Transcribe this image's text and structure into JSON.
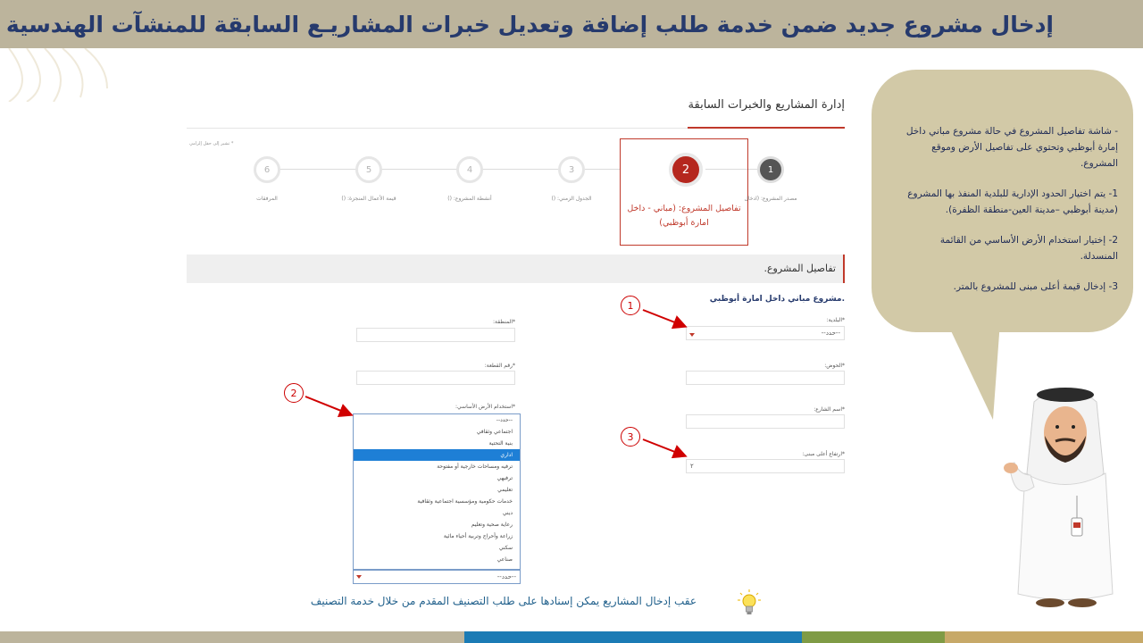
{
  "header": {
    "title": "إدخال مشروع جديد ضمن خدمة طلب إضافة وتعديل خبرات المشاريـع السابقة للمنشآت الهندسية"
  },
  "colors": {
    "header_bg": "#bcb49c",
    "title_color": "#263a6d",
    "accent_red": "#c0392b",
    "bubble_bg": "#d2c9a7",
    "bar_1": "#bcb49c",
    "bar_2": "#1b7bb5",
    "bar_3": "#7f9b45",
    "bar_4": "#c7a968"
  },
  "bubble": {
    "intro": "-    شاشة تفاصيل المشروع في حالة مشروع مباني داخل إمارة أبوظبي وتحتوي على تفاصيل الأرض وموقع المشروع.",
    "point_1": "1- يتم اختيار الحدود الإدارية للبلدية المنفذ بها المشروع (مدينة أبوظبي –مدينة العين-منطقة الظفرة).",
    "point_2": "2- إختيار استخدام الأرض الأساسي من القائمة المنسدلة.",
    "point_3": "3- إدخال قيمة أعلى مبنى للمشروع بالمتر."
  },
  "app": {
    "management_title": "إدارة المشاريع والخبرات السابقة",
    "required_note": "* تشير إلى حقل إلزامي"
  },
  "stepper": {
    "steps": [
      {
        "number": "1",
        "label": "مصدر المشروع: (ادخال"
      },
      {
        "number": "2",
        "label": "تفاصيل المشروع: (مباني - داخل امارة أبوظبي)"
      },
      {
        "number": "3",
        "label": "الجدول الزمني: ()"
      },
      {
        "number": "4",
        "label": "أنشطة المشروع: ()"
      },
      {
        "number": "5",
        "label": "قيمة الأعمال المنجزة: ()"
      },
      {
        "number": "6",
        "label": "المرفقات"
      }
    ]
  },
  "section": {
    "title": "تفاصيل المشروع.",
    "subtitle": ".مشروع مباني داخل امارة أبوظبي"
  },
  "form": {
    "municipality_label": "*البلدية:",
    "municipality_value": "--حدد--",
    "region_label": "*المنطقة:",
    "basin_label": "*الحوض:",
    "plot_label": "*رقم القطعة:",
    "land_use_label": "*استخدام الأرض الأساسي:",
    "street_label": "*اسم الشارع:",
    "height_label": "*ارتفاع أعلى مبنى:",
    "height_value": "٢",
    "land_use_value": "--حدد--"
  },
  "dropdown": {
    "options": [
      "--حدد--",
      "اجتماعي وثقافي",
      "بنية التحتية",
      "اداري",
      "ترفيه ومساحات خارجية أو مفتوحة",
      "ترفيهي",
      "تعليمي",
      "خدمات حكومية ومؤسسية اجتماعية وثقافية",
      "ديني",
      "رعاية صحية وتعليم",
      "زراعة وأحراج وتربية أحياء مائية",
      "سكني",
      "صناعي"
    ],
    "selected_index": 3
  },
  "markers": [
    "1",
    "2",
    "3"
  ],
  "footer": {
    "note": "عقب إدخال المشاريع يمكن إسنادها على طلب التصنيف المقدم من خلال خدمة التصنيف"
  },
  "icons": {
    "bulb": "lightbulb-icon",
    "person": "emirati-man-illustration"
  }
}
